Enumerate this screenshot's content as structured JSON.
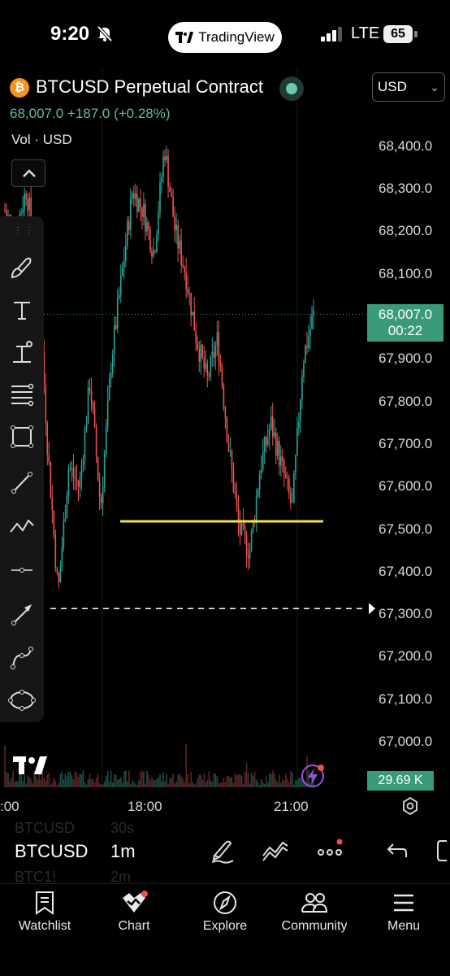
{
  "status": {
    "time": "9:20",
    "carrier": "LTE",
    "battery": "65",
    "app_pill": "TradingView"
  },
  "header": {
    "symbol_title": "BTCUSD Perpetual Contract",
    "currency": "USD",
    "price_line": "68,007.0 +187.0 (+0.28%)",
    "vol_line": "Vol · USD"
  },
  "chart_data": {
    "type": "candlestick",
    "symbol": "BTCUSD",
    "timeframe": "1m",
    "y_ticks": [
      "68,400.0",
      "68,300.0",
      "68,200.0",
      "68,100.0",
      "67,900.0",
      "67,800.0",
      "67,700.0",
      "67,600.0",
      "67,500.0",
      "67,400.0",
      "67,300.0",
      "67,200.0",
      "67,100.0",
      "67,000.0"
    ],
    "ylim": [
      66950,
      68480
    ],
    "x_ticks": [
      ":00",
      "18:00",
      "21:00"
    ],
    "last_price": "68,007.0",
    "countdown": "00:22",
    "volume_last": "29.69 K",
    "price_series": [
      68250,
      68200,
      68300,
      68150,
      67700,
      67350,
      67650,
      67600,
      67850,
      67550,
      67900,
      68100,
      68300,
      68250,
      68150,
      68400,
      68200,
      68100,
      67950,
      67850,
      67950,
      67700,
      67500,
      67450,
      67650,
      67750,
      67650,
      67550,
      67900,
      68007
    ],
    "horizontal_lines": [
      67520,
      67315
    ],
    "colors": {
      "up": "#26a69a",
      "down": "#ef5350",
      "hline_yellow": "#f5e14a",
      "badge": "#3a9a7c"
    }
  },
  "bottom": {
    "symbol": "BTCUSD",
    "timeframe": "1m",
    "ghost_row1_sym": "BTCUSD",
    "ghost_row1_tf": "30s",
    "ghost_row2_sym": "BTC1!",
    "ghost_row2_tf": "2m"
  },
  "tabs": [
    {
      "label": "Watchlist",
      "icon": "bookmark-icon"
    },
    {
      "label": "Chart",
      "icon": "chart-icon"
    },
    {
      "label": "Explore",
      "icon": "compass-icon"
    },
    {
      "label": "Community",
      "icon": "people-icon"
    },
    {
      "label": "Menu",
      "icon": "hamburger-icon"
    }
  ]
}
